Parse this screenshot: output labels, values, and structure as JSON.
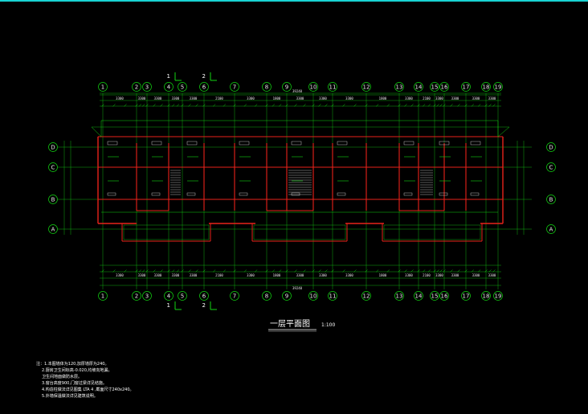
{
  "drawing": {
    "title": "一层平面图",
    "scale": "1:100",
    "overall_dimension_top": "39240",
    "overall_dimension_bottom": "39240"
  },
  "axes": {
    "columns": [
      "1",
      "2",
      "3",
      "4",
      "5",
      "6",
      "7",
      "8",
      "9",
      "10",
      "11",
      "12",
      "13",
      "14",
      "15",
      "16",
      "17",
      "18",
      "19"
    ],
    "rows": [
      "D",
      "C",
      "B",
      "A"
    ]
  },
  "section_marks": {
    "top": [
      {
        "label": "1"
      },
      {
        "label": "2"
      }
    ],
    "bottom": [
      {
        "label": "1"
      },
      {
        "label": "2"
      }
    ]
  },
  "dimensions_top": [
    "3300",
    "3300",
    "3300",
    "3300",
    "3300",
    "2100",
    "3300",
    "1800",
    "3300",
    "3300",
    "3300",
    "1800",
    "3300",
    "2100",
    "3300",
    "3300",
    "3300",
    "3300"
  ],
  "dimensions_bottom": [
    "3300",
    "3300",
    "3300",
    "3300",
    "3300",
    "2100",
    "3300",
    "1800",
    "3300",
    "3300",
    "3300",
    "1800",
    "3300",
    "2100",
    "3300",
    "3300",
    "3300",
    "3300"
  ],
  "notes": [
    "注：1.本图墙体为120,加厚墙厚为240。",
    "2.厨房卫生间标高-0.020,均坡向地漏。",
    "卫生间地面做防水层。",
    "3.窗台高度900,门窗过梁详见结施。",
    "4.构造柱做法详见图集 LTA 4 ,截面尺寸240x240。",
    "5.外墙保温做法详见建筑说明。"
  ],
  "colors": {
    "grid": "#12d412",
    "wall": "#e8221a",
    "text": "#e8e8e8",
    "topline": "#19d3d3"
  }
}
